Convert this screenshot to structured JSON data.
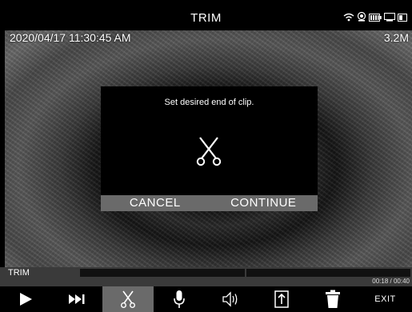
{
  "header": {
    "title": "TRIM",
    "status_icons": [
      "wifi-icon",
      "record-icon",
      "battery-icon",
      "storage-icon",
      "card-icon"
    ]
  },
  "overlay": {
    "timestamp": "2020/04/17 11:30:45 AM",
    "resolution": "3.2M"
  },
  "dialog": {
    "message": "Set desired end of clip.",
    "icon": "scissors-icon",
    "cancel_label": "CANCEL",
    "continue_label": "CONTINUE"
  },
  "trim": {
    "label": "TRIM",
    "time": "00:18 / 00:40"
  },
  "toolbar": {
    "tools": [
      "play-icon",
      "skip-forward-icon",
      "scissors-icon",
      "microphone-icon",
      "speaker-icon",
      "export-icon",
      "trash-icon"
    ],
    "active_tool": "scissors-icon",
    "exit_label": "EXIT"
  }
}
